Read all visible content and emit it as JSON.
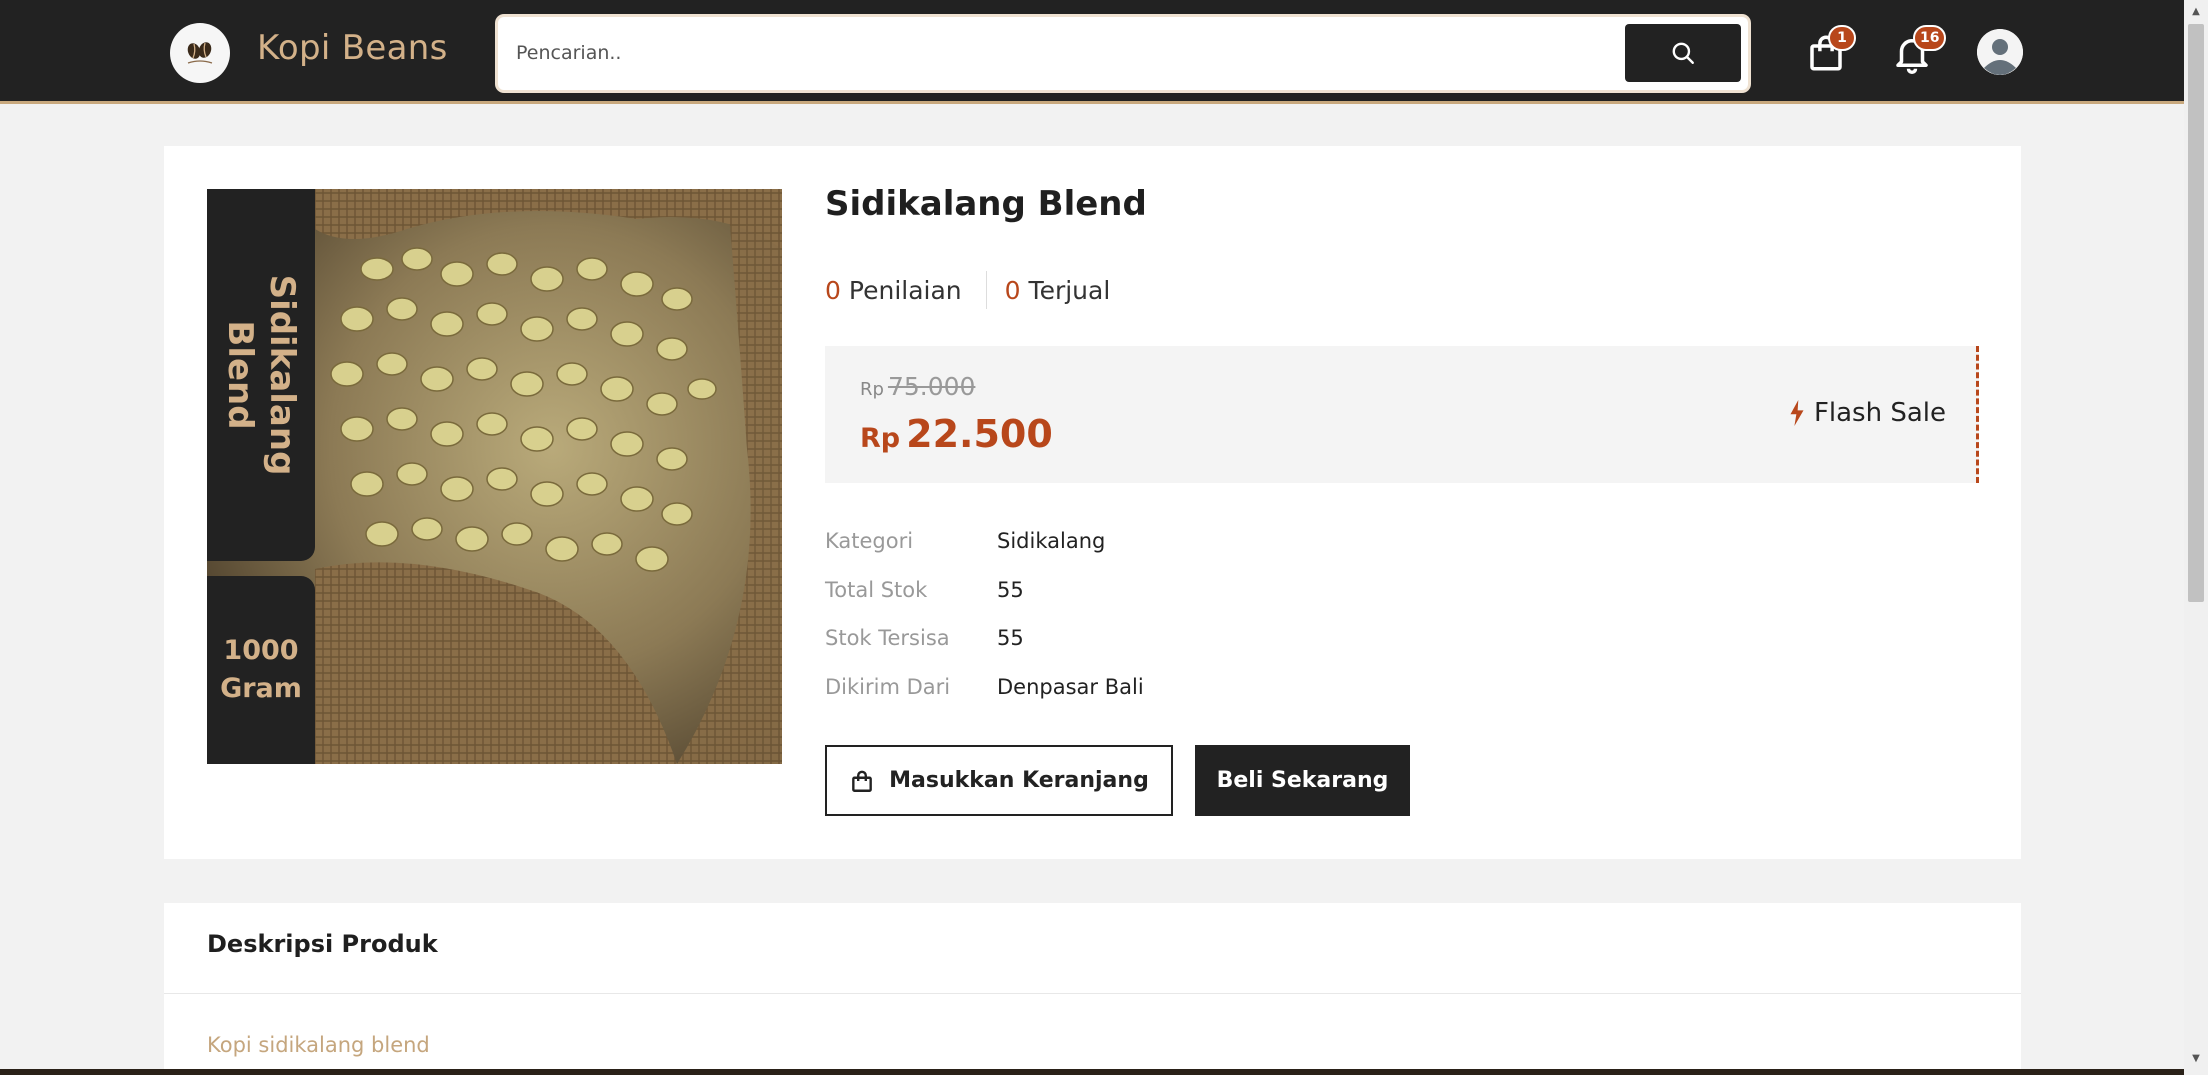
{
  "header": {
    "brand": "Kopi Beans",
    "search_placeholder": "Pencarian..",
    "cart_count": "1",
    "notification_count": "16"
  },
  "product": {
    "title": "Sidikalang Blend",
    "image_label_name": "Sidikalang\nBlend",
    "image_label_weight": "1000\nGram",
    "rating_count": "0",
    "rating_label": "Penilaian",
    "sold_count": "0",
    "sold_label": "Terjual",
    "currency": "Rp",
    "old_price": "75.000",
    "new_price": "22.500",
    "flash_sale_label": "Flash Sale",
    "details": [
      {
        "label": "Kategori",
        "value": "Sidikalang"
      },
      {
        "label": "Total Stok",
        "value": "55"
      },
      {
        "label": "Stok Tersisa",
        "value": "55"
      },
      {
        "label": "Dikirim Dari",
        "value": "Denpasar Bali"
      }
    ],
    "add_to_cart_label": "Masukkan Keranjang",
    "buy_now_label": "Beli Sekarang"
  },
  "description": {
    "title": "Deskripsi Produk",
    "text": "Kopi sidikalang blend"
  },
  "colors": {
    "header_bg": "#222222",
    "accent": "#b8471b",
    "brand_gold": "#d3b189"
  },
  "icons": [
    "search-icon",
    "shopping-bag-icon",
    "bell-icon",
    "user-avatar-icon",
    "lightning-icon"
  ]
}
